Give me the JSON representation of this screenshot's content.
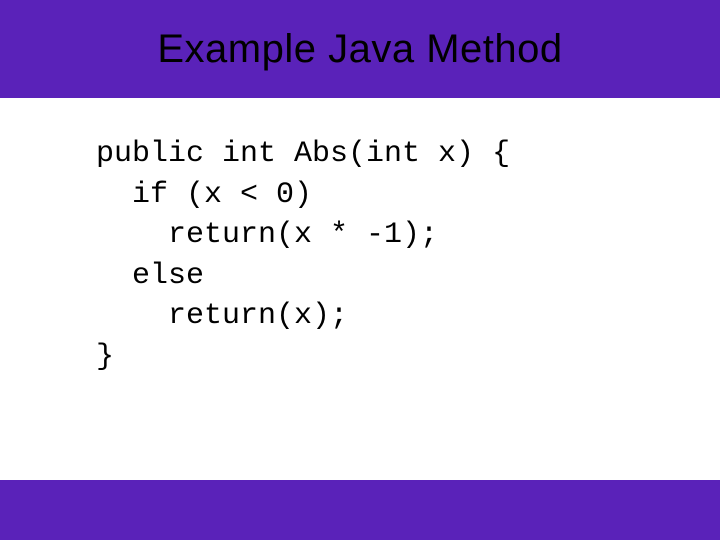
{
  "slide": {
    "title": "Example Java Method",
    "code": "public int Abs(int x) {\n  if (x < 0)\n    return(x * -1);\n  else\n    return(x);\n}"
  }
}
